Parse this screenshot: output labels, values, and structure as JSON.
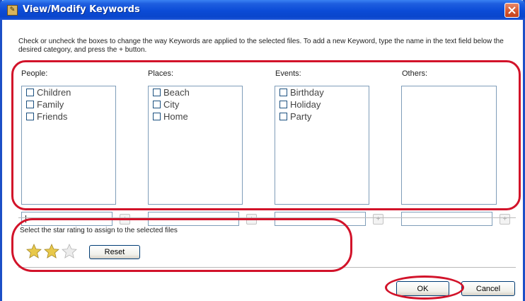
{
  "window": {
    "title": "View/Modify Keywords"
  },
  "instructions": "Check or uncheck the boxes to change the way Keywords are applied to the selected files. To add a new Keyword, type the name in the text field below the desired category, and press the + button.",
  "categories": [
    {
      "label": "People:",
      "keywords": [
        "Children",
        "Family",
        "Friends"
      ],
      "new_keyword_value": "|"
    },
    {
      "label": "Places:",
      "keywords": [
        "Beach",
        "City",
        "Home"
      ],
      "new_keyword_value": ""
    },
    {
      "label": "Events:",
      "keywords": [
        "Birthday",
        "Holiday",
        "Party"
      ],
      "new_keyword_value": ""
    },
    {
      "label": "Others:",
      "keywords": [],
      "new_keyword_value": ""
    }
  ],
  "add_button_label": "+",
  "rating": {
    "label": "Select the star rating to assign to the selected files",
    "value": 2,
    "max": 3,
    "reset_label": "Reset"
  },
  "buttons": {
    "ok": "OK",
    "cancel": "Cancel"
  },
  "colors": {
    "annotation": "#d2132a",
    "title_bar": "#0b4bd6",
    "star_filled": "#e8c84a",
    "star_empty": "#d9d9d9"
  }
}
